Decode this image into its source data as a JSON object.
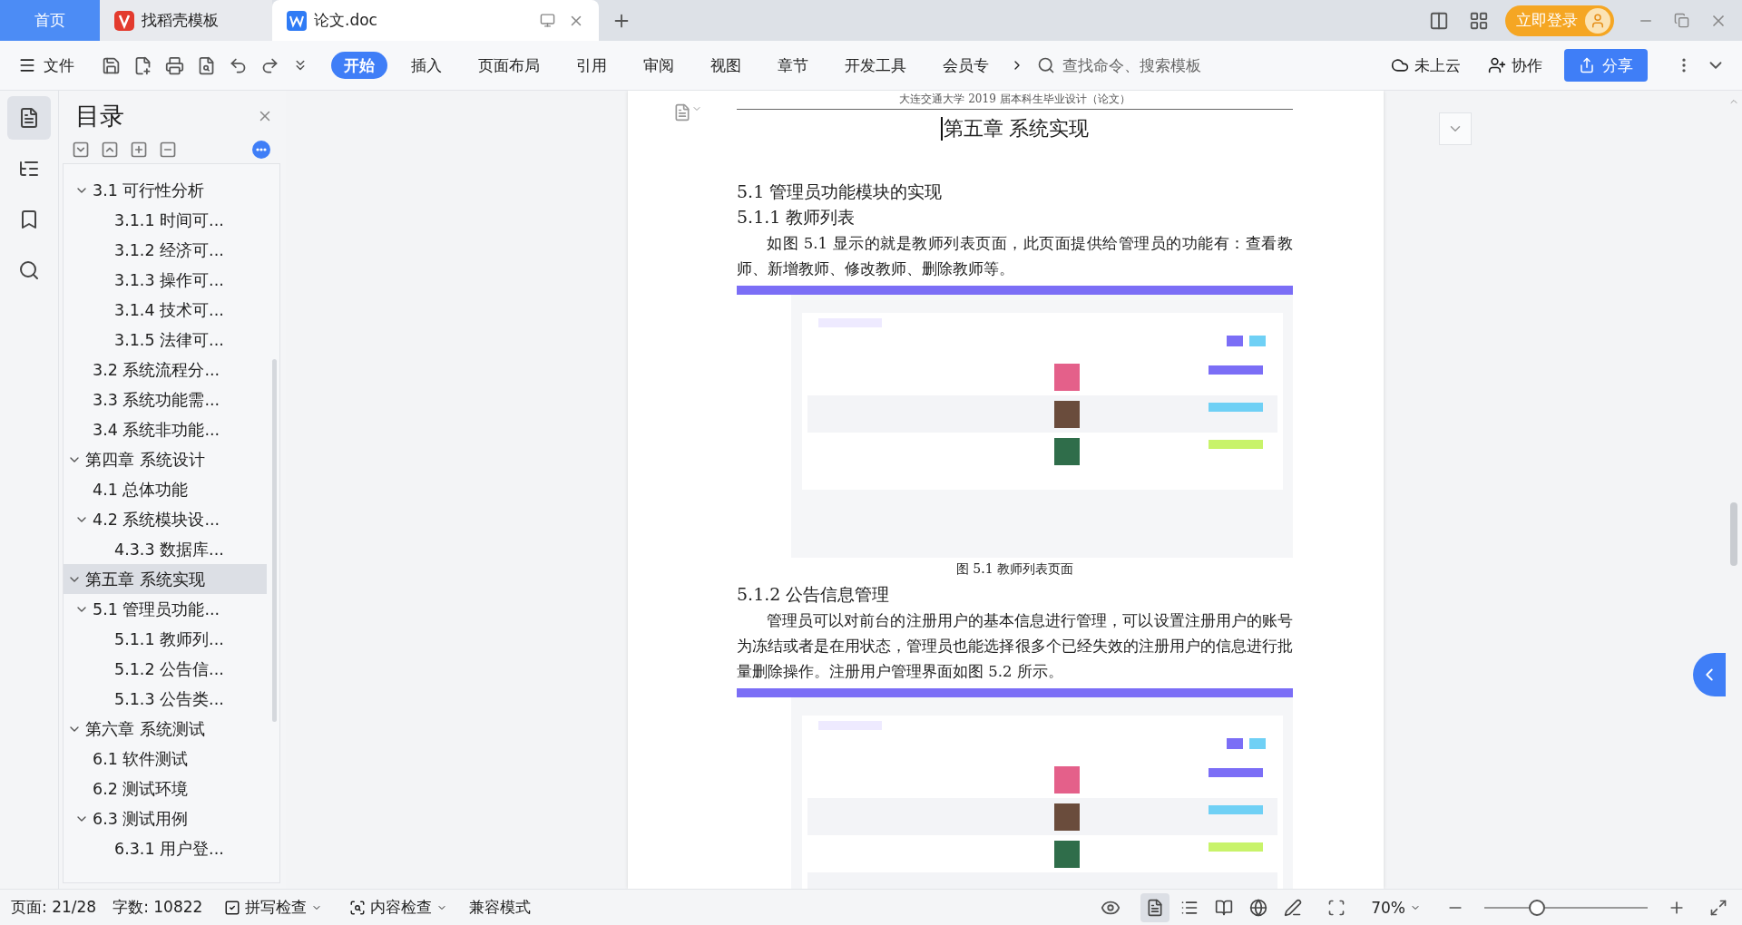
{
  "tabs": [
    {
      "label": "首页",
      "kind": "home",
      "selected": false
    },
    {
      "label": "找稻壳模板",
      "kind": "template",
      "selected": false
    },
    {
      "label": "论文.doc",
      "kind": "document",
      "selected": true
    }
  ],
  "login_button": "立即登录",
  "toolbar": {
    "file_menu": "文件",
    "ribbon_tabs": [
      {
        "label": "开始",
        "selected": true
      },
      {
        "label": "插入",
        "selected": false
      },
      {
        "label": "页面布局",
        "selected": false
      },
      {
        "label": "引用",
        "selected": false
      },
      {
        "label": "审阅",
        "selected": false
      },
      {
        "label": "视图",
        "selected": false
      },
      {
        "label": "章节",
        "selected": false
      },
      {
        "label": "开发工具",
        "selected": false
      },
      {
        "label": "会员专",
        "selected": false
      }
    ],
    "search": {
      "placeholder": "查找命令、搜索模板"
    },
    "cloud": "未上云",
    "collaborate": "协作",
    "share": "分享"
  },
  "rail": [
    {
      "kind": "toc",
      "selected": true
    },
    {
      "kind": "navigation",
      "selected": false
    },
    {
      "kind": "bookmark",
      "selected": false
    },
    {
      "kind": "search",
      "selected": false
    }
  ],
  "sidebar": {
    "title": "目录",
    "items": [
      {
        "children": [
          {
            "label": "3.1 可行性分析",
            "expanded": true,
            "selected": false,
            "children": [
              {
                "label": "3.1.1 时间可...",
                "selected": false
              },
              {
                "label": "3.1.2  经济可...",
                "selected": false
              },
              {
                "label": "3.1.3  操作可...",
                "selected": false
              },
              {
                "label": "3.1.4  技术可...",
                "selected": false
              },
              {
                "label": "3.1.5  法律可...",
                "selected": false
              }
            ]
          },
          {
            "label": "3.2 系统流程分...",
            "selected": false
          },
          {
            "label": "3.3 系统功能需...",
            "selected": false
          },
          {
            "label": "3.4  系统非功能...",
            "selected": false
          }
        ]
      },
      {
        "label": "第四章  系统设计",
        "expanded": true,
        "selected": false,
        "children": [
          {
            "label": "4.1  总体功能",
            "selected": false
          },
          {
            "label": "4.2  系统模块设...",
            "expanded": true,
            "selected": false,
            "children": [
              {
                "label": "4.3.3  数据库...",
                "selected": false
              }
            ]
          }
        ]
      },
      {
        "label": "第五章  系统实现",
        "expanded": true,
        "selected": true,
        "children": [
          {
            "label": "5.1  管理员功能...",
            "expanded": true,
            "selected": false,
            "children": [
              {
                "label": "5.1.1  教师列...",
                "selected": false
              },
              {
                "label": "5.1.2  公告信...",
                "selected": false
              },
              {
                "label": "5.1.3  公告类...",
                "selected": false
              }
            ]
          }
        ]
      },
      {
        "label": "第六章  系统测试",
        "expanded": true,
        "selected": false,
        "children": [
          {
            "label": "6.1 软件测试",
            "selected": false
          },
          {
            "label": "6.2 测试环境",
            "selected": false
          },
          {
            "label": "6.3  测试用例",
            "expanded": true,
            "selected": false,
            "children": [
              {
                "label": "6.3.1  用户登...",
                "selected": false
              }
            ]
          }
        ]
      }
    ]
  },
  "document": {
    "header": "大连交通大学 2019 届本科生毕业设计（论文）",
    "blocks": [
      {
        "kind": "chapter",
        "text": "第五章  系统实现"
      },
      {
        "kind": "heading",
        "text": "5.1  管理员功能模块的实现"
      },
      {
        "kind": "subheading",
        "text": "5.1.1  教师列表"
      },
      {
        "kind": "paragraph",
        "text": "如图 5.1 显示的就是教师列表页面，此页面提供给管理员的功能有：查看教师、新增教师、修改教师、删除教师等。"
      },
      {
        "kind": "picture"
      },
      {
        "kind": "caption",
        "text": "图 5.1  教师列表页面"
      },
      {
        "kind": "subheading",
        "text": "5.1.2  公告信息管理"
      },
      {
        "kind": "paragraph",
        "text": "管理员可以对前台的注册用户的基本信息进行管理，可以设置注册用户的账号为冻结或者是在用状态，管理员也能选择很多个已经失效的注册用户的信息进行批量删除操作。注册用户管理界面如图 5.2 所示。"
      },
      {
        "kind": "picture"
      }
    ]
  },
  "status_bar": {
    "page": "页面: 21/28",
    "words": "字数: 10822",
    "spell_check": "拼写检查",
    "content_check": "内容检查",
    "compat_mode": "兼容模式",
    "view_modes": [
      {
        "kind": "page",
        "selected": true
      },
      {
        "kind": "outline",
        "selected": false
      },
      {
        "kind": "reading",
        "selected": false
      },
      {
        "kind": "web",
        "selected": false
      },
      {
        "kind": "write",
        "selected": false
      }
    ],
    "zoom": "70%",
    "zoom_slider": {
      "level": 0.32
    }
  }
}
